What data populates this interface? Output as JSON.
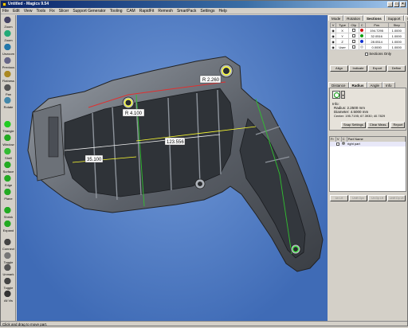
{
  "window": {
    "title": "Untitled - Magics 9.54",
    "min": "_",
    "max": "□",
    "close": "×"
  },
  "menu": [
    "File",
    "Edit",
    "View",
    "Tools",
    "Fix",
    "Slicer",
    "Support Generator",
    "Tooling",
    "CAM",
    "RapidFit",
    "Remesh",
    "SmartPack",
    "Settings",
    "Help"
  ],
  "toolbar": [
    {
      "label": "Zoom",
      "icon": "zoom-icon"
    },
    {
      "label": "Zoom",
      "icon": "zoom-in-icon"
    },
    {
      "label": "Unzoom",
      "icon": "unzoom-icon"
    },
    {
      "label": "Previous",
      "icon": "previous-view-icon"
    },
    {
      "label": "Flatness",
      "icon": "flatness-icon"
    },
    {
      "label": "Pan",
      "icon": "pan-icon"
    },
    {
      "label": "Rotate",
      "icon": "rotate-icon"
    },
    {
      "label": "Triangle",
      "icon": "triangle-select-icon"
    },
    {
      "label": "Window",
      "icon": "window-select-icon"
    },
    {
      "label": "Shell",
      "icon": "shell-select-icon"
    },
    {
      "label": "Surface",
      "icon": "surface-select-icon"
    },
    {
      "label": "Edge",
      "icon": "edge-select-icon"
    },
    {
      "label": "Plane",
      "icon": "plane-select-icon"
    },
    {
      "label": "Shrink",
      "icon": "shrink-icon"
    },
    {
      "label": "Expand",
      "icon": "expand-icon"
    },
    {
      "label": "Connect",
      "icon": "connect-icon"
    },
    {
      "label": "Toggle",
      "icon": "toggle-icon"
    },
    {
      "label": "Unmark",
      "icon": "unmark-icon"
    },
    {
      "label": "Toggle",
      "icon": "toggle-all-icon"
    },
    {
      "label": "All Vis",
      "icon": "all-visible-icon"
    }
  ],
  "viewport": {
    "annotations": [
      "R 2.260",
      "R 4.100",
      "123.556",
      "35.100"
    ],
    "background": "#4f7cc4"
  },
  "panel": {
    "tabs_top": [
      "Mode",
      "Rotation",
      "Sections",
      "Support",
      "Grid"
    ],
    "section_table": {
      "headers": [
        "V",
        "Type",
        "Clip",
        "C",
        "Pos",
        "Step"
      ],
      "rows": [
        {
          "type": "X",
          "color": "#d01010",
          "pos": "194.7295",
          "step": "1.0000"
        },
        {
          "type": "Y",
          "color": "#10a010",
          "pos": "32.0516",
          "step": "1.0000"
        },
        {
          "type": "Z",
          "color": "#1030d0",
          "pos": "28.0514",
          "step": "1.0000"
        },
        {
          "type": "User",
          "color": "#d0d0d0",
          "pos": "0.0000",
          "step": "1.0000"
        }
      ]
    },
    "sections_only": "Sections Only",
    "section_buttons": [
      "Align",
      "Indicate",
      "Export",
      "Define"
    ],
    "tabs_measure": [
      "Distance",
      "Radius",
      "Angle",
      "Info"
    ],
    "info": {
      "title": "Info:",
      "lines": [
        "Radius: 2.2500 mm",
        "Diameter: 4.5000 mm",
        "Center: 195.7195; 67.3930; 40.7829"
      ]
    },
    "measure_buttons": [
      "Snap Settings",
      "Clear Meas.",
      "Report"
    ],
    "parts_headers": [
      "Fr",
      "V",
      "C",
      "Part Name"
    ],
    "parts_rows": [
      {
        "name": "right part"
      }
    ],
    "bottom_buttons": [
      "Un Lft",
      "Unlft Opn",
      "Un Dp Lft",
      "Unlft Dp Lft"
    ]
  },
  "status": "Click and drag to move part."
}
